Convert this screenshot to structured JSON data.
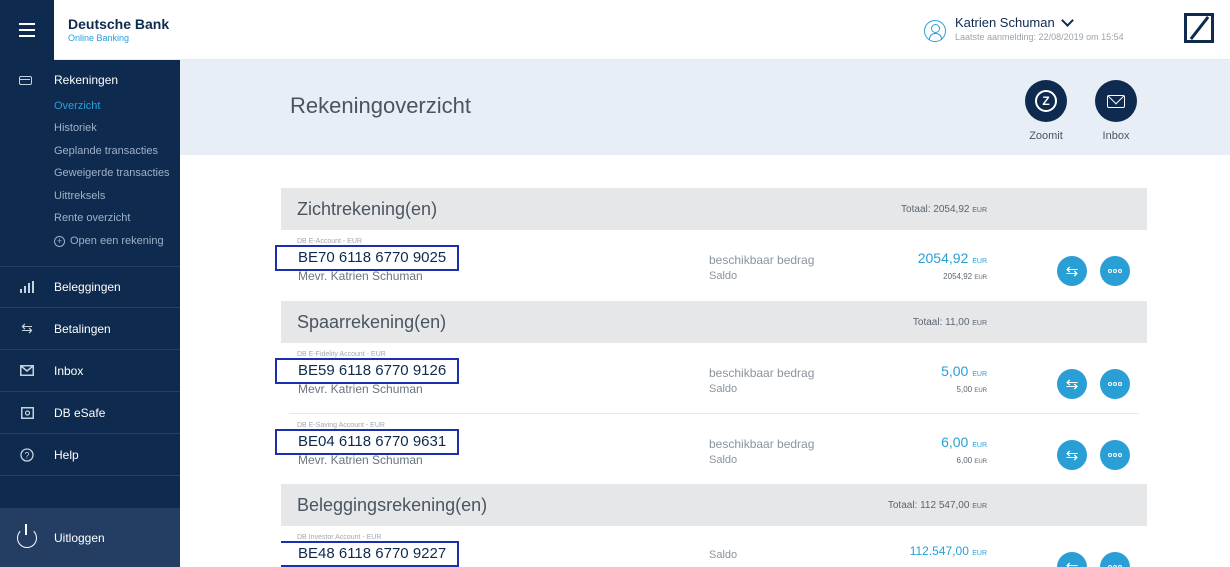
{
  "header": {
    "brand_name": "Deutsche Bank",
    "brand_sub": "Online Banking",
    "user_name": "Katrien Schuman",
    "last_login": "Laatste aanmelding: 22/08/2019 om 15:54"
  },
  "sidebar": {
    "accounts_label": "Rekeningen",
    "sub_items": [
      "Overzicht",
      "Historiek",
      "Geplande transacties",
      "Geweigerde transacties",
      "Uittreksels",
      "Rente overzicht"
    ],
    "open_account": "Open een rekening",
    "items": [
      {
        "label": "Beleggingen",
        "icon": "chart-icon"
      },
      {
        "label": "Betalingen",
        "icon": "transfer-icon"
      },
      {
        "label": "Inbox",
        "icon": "mail-icon"
      },
      {
        "label": "DB eSafe",
        "icon": "safe-icon"
      },
      {
        "label": "Help",
        "icon": "help-icon"
      }
    ],
    "logout": "Uitloggen"
  },
  "main": {
    "title": "Rekeningoverzicht",
    "zoomit_label": "Zoomit",
    "inbox_label": "Inbox"
  },
  "sections": [
    {
      "title": "Zichtrekening(en)",
      "total": "Totaal: 2054,92",
      "currency": "EUR"
    },
    {
      "title": "Spaarrekening(en)",
      "total": "Totaal: 11,00",
      "currency": "EUR"
    },
    {
      "title": "Beleggingsrekening(en)",
      "total": "Totaal: 112 547,00",
      "currency": "EUR"
    }
  ],
  "accounts": [
    {
      "type": "DB E-Account - EUR",
      "iban": "BE70 6118 6770 9025",
      "holder": "Mevr. Katrien Schuman",
      "label1": "beschikbaar bedrag",
      "label2": "Saldo",
      "available": "2054,92",
      "balance": "2054,92",
      "currency": "EUR"
    },
    {
      "type": "DB E-Fidelity Account - EUR",
      "iban": "BE59 6118 6770 9126",
      "holder": "Mevr. Katrien Schuman",
      "label1": "beschikbaar bedrag",
      "label2": "Saldo",
      "available": "5,00",
      "balance": "5,00",
      "currency": "EUR"
    },
    {
      "type": "DB E-Saving Account - EUR",
      "iban": "BE04 6118 6770 9631",
      "holder": "Mevr. Katrien Schuman",
      "label1": "beschikbaar bedrag",
      "label2": "Saldo",
      "available": "6,00",
      "balance": "6,00",
      "currency": "EUR"
    },
    {
      "type": "DB Investor Account - EUR",
      "iban": "BE48 6118 6770 9227",
      "label2": "Saldo",
      "available": "112.547,00",
      "currency": "EUR"
    }
  ],
  "colors": {
    "navy": "#0e2a4f",
    "accent": "#2a9fd6",
    "highlight_box": "#1c2fae"
  }
}
